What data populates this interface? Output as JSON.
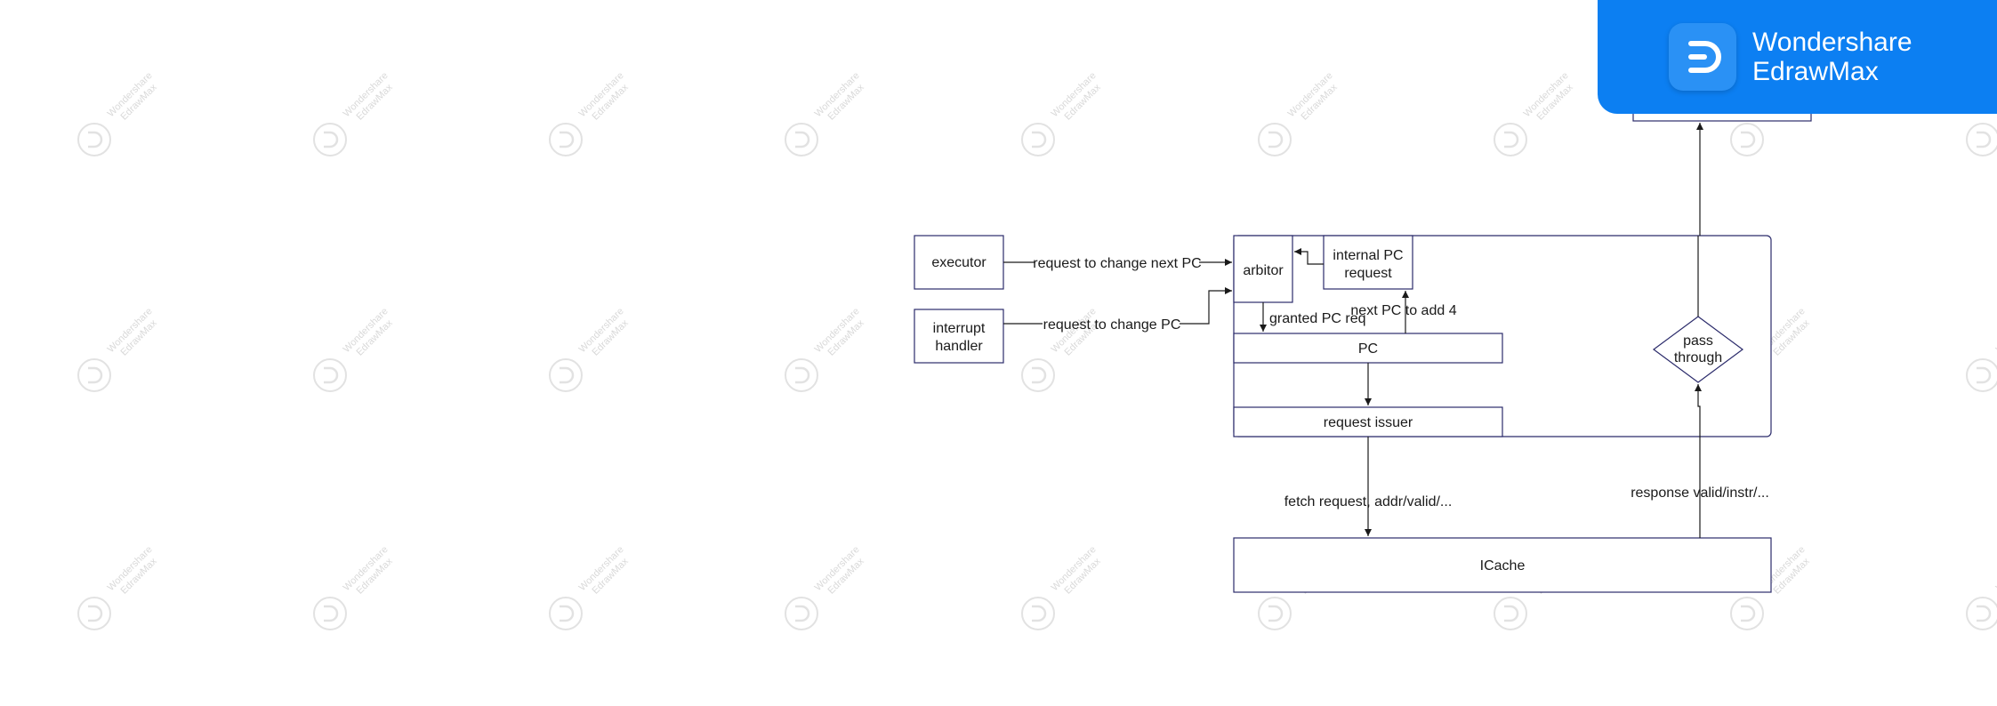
{
  "brand": {
    "line1": "Wondershare",
    "line2": "EdrawMax",
    "banner_color": "#0c7ff2"
  },
  "watermark": {
    "line1": "Wondershare",
    "line2": "EdrawMax",
    "icon": "edrawmax-logo-icon"
  },
  "diagram": {
    "nodes": {
      "executor": "executor",
      "interrupt_handler_line1": "interrupt",
      "interrupt_handler_line2": "handler",
      "arbitor": "arbitor",
      "internal_pc_line1": "internal PC",
      "internal_pc_line2": "request",
      "pc": "PC",
      "request_issuer": "request issuer",
      "pass_through_line1": "pass",
      "pass_through_line2": "through",
      "icache": "ICache"
    },
    "edges": {
      "executor_to_arbitor": "request to change next PC",
      "interrupt_to_arbitor": "request to change PC",
      "granted": "granted PC req",
      "next_pc": "next PC to add 4",
      "fetch_request": "fetch request, addr/valid/...",
      "response": "response valid/instr/..."
    },
    "colors": {
      "border": "#2b2b6b",
      "line": "#1a1a1a"
    }
  }
}
